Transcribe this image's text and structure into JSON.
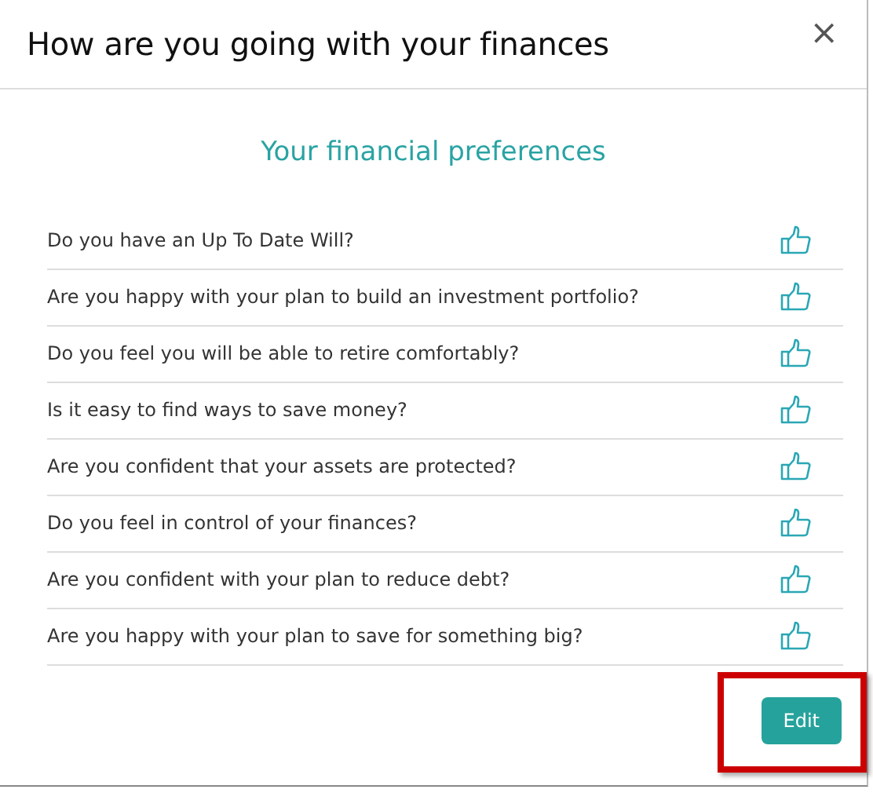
{
  "dialog": {
    "title": "How are you going with your finances",
    "close": "×"
  },
  "subtitle": "Your financial preferences",
  "questions": [
    {
      "text": "Do you have an Up To Date Will?"
    },
    {
      "text": "Are you happy with your plan to build an investment portfolio?"
    },
    {
      "text": "Do you feel you will be able to retire comfortably?"
    },
    {
      "text": "Is it easy to find ways to save money?"
    },
    {
      "text": "Are you confident that your assets are protected?"
    },
    {
      "text": "Do you feel in control of your finances?"
    },
    {
      "text": "Are you confident with your plan to reduce debt?"
    },
    {
      "text": "Are you happy with your plan to save for something big?"
    }
  ],
  "edit_button": {
    "label": "Edit",
    "highlighted": true
  }
}
